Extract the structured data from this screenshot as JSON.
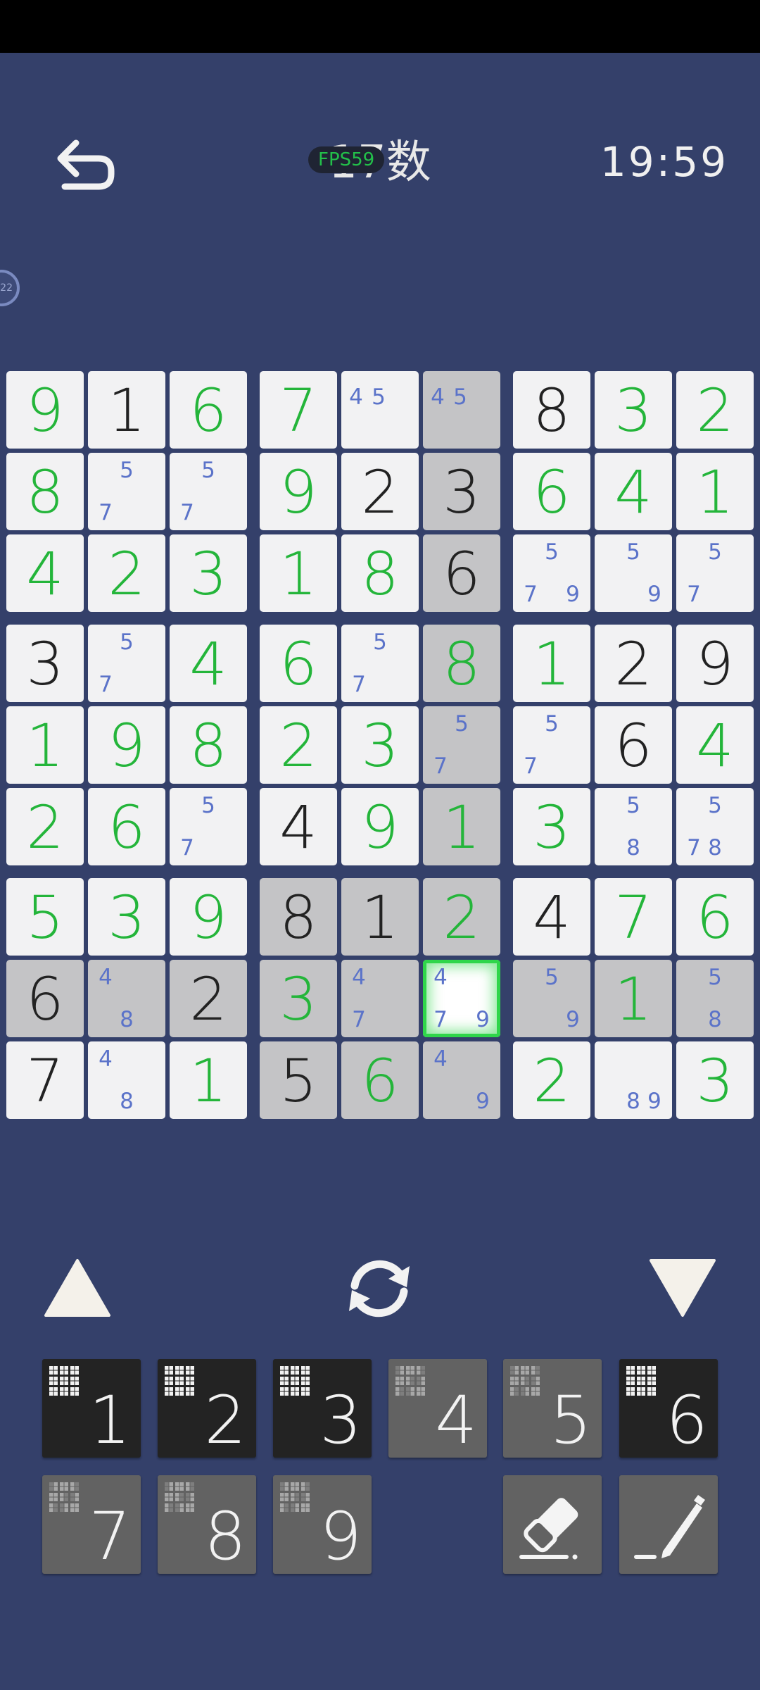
{
  "header": {
    "fps_label": "FPS59",
    "title": "17数",
    "timer": "19:59",
    "side_badge": "22"
  },
  "icons": {
    "back": "back-arrow-icon",
    "up": "triangle-up-icon",
    "down": "triangle-down-icon",
    "refresh": "refresh-icon",
    "eraser": "eraser-icon",
    "pencil": "pencil-icon",
    "mini_grid": "mini-grid-icon"
  },
  "colors": {
    "background": "#34406a",
    "given_digit": "#222222",
    "user_digit": "#24b53a",
    "note_digit": "#5b73c9",
    "highlight_cell": "#c4c4c6",
    "selected_outline": "#2fd64a"
  },
  "board": {
    "rows": [
      [
        {
          "v": "9",
          "t": "user"
        },
        {
          "v": "1",
          "t": "given"
        },
        {
          "v": "6",
          "t": "user"
        },
        {
          "v": "7",
          "t": "user"
        },
        {
          "n": [
            "4",
            "5"
          ]
        },
        {
          "n": [
            "4",
            "5"
          ],
          "hl": true
        },
        {
          "v": "8",
          "t": "given"
        },
        {
          "v": "3",
          "t": "user"
        },
        {
          "v": "2",
          "t": "user"
        }
      ],
      [
        {
          "v": "8",
          "t": "user"
        },
        {
          "n": [
            "5",
            "7"
          ]
        },
        {
          "n": [
            "5",
            "7"
          ]
        },
        {
          "v": "9",
          "t": "user"
        },
        {
          "v": "2",
          "t": "given"
        },
        {
          "v": "3",
          "t": "given",
          "hl": true
        },
        {
          "v": "6",
          "t": "user"
        },
        {
          "v": "4",
          "t": "user"
        },
        {
          "v": "1",
          "t": "user"
        }
      ],
      [
        {
          "v": "4",
          "t": "user"
        },
        {
          "v": "2",
          "t": "user"
        },
        {
          "v": "3",
          "t": "user"
        },
        {
          "v": "1",
          "t": "user"
        },
        {
          "v": "8",
          "t": "user"
        },
        {
          "v": "6",
          "t": "given",
          "hl": true
        },
        {
          "n": [
            "5",
            "7",
            "9"
          ]
        },
        {
          "n": [
            "5",
            "9"
          ]
        },
        {
          "n": [
            "5",
            "7"
          ]
        }
      ],
      [
        {
          "v": "3",
          "t": "given"
        },
        {
          "n": [
            "5",
            "7"
          ]
        },
        {
          "v": "4",
          "t": "user"
        },
        {
          "v": "6",
          "t": "user"
        },
        {
          "n": [
            "5",
            "7"
          ]
        },
        {
          "v": "8",
          "t": "user",
          "hl": true
        },
        {
          "v": "1",
          "t": "user"
        },
        {
          "v": "2",
          "t": "given"
        },
        {
          "v": "9",
          "t": "given"
        }
      ],
      [
        {
          "v": "1",
          "t": "user"
        },
        {
          "v": "9",
          "t": "user"
        },
        {
          "v": "8",
          "t": "user"
        },
        {
          "v": "2",
          "t": "user"
        },
        {
          "v": "3",
          "t": "user"
        },
        {
          "n": [
            "5",
            "7"
          ],
          "hl": true
        },
        {
          "n": [
            "5",
            "7"
          ]
        },
        {
          "v": "6",
          "t": "given"
        },
        {
          "v": "4",
          "t": "user"
        }
      ],
      [
        {
          "v": "2",
          "t": "user"
        },
        {
          "v": "6",
          "t": "user"
        },
        {
          "n": [
            "5",
            "7"
          ]
        },
        {
          "v": "4",
          "t": "given"
        },
        {
          "v": "9",
          "t": "user"
        },
        {
          "v": "1",
          "t": "user",
          "hl": true
        },
        {
          "v": "3",
          "t": "user"
        },
        {
          "n": [
            "5",
            "8"
          ]
        },
        {
          "n": [
            "5",
            "7",
            "8"
          ]
        }
      ],
      [
        {
          "v": "5",
          "t": "user"
        },
        {
          "v": "3",
          "t": "user"
        },
        {
          "v": "9",
          "t": "user"
        },
        {
          "v": "8",
          "t": "given",
          "hl": true
        },
        {
          "v": "1",
          "t": "given",
          "hl": true
        },
        {
          "v": "2",
          "t": "user",
          "hl": true
        },
        {
          "v": "4",
          "t": "given"
        },
        {
          "v": "7",
          "t": "user"
        },
        {
          "v": "6",
          "t": "user"
        }
      ],
      [
        {
          "v": "6",
          "t": "given",
          "hl": true
        },
        {
          "n": [
            "4",
            "8"
          ],
          "hl": true
        },
        {
          "v": "2",
          "t": "given",
          "hl": true
        },
        {
          "v": "3",
          "t": "user",
          "hl": true
        },
        {
          "n": [
            "4",
            "7"
          ],
          "hl": true
        },
        {
          "n": [
            "4",
            "7",
            "9"
          ],
          "sel": true
        },
        {
          "n": [
            "5",
            "9"
          ],
          "hl": true
        },
        {
          "v": "1",
          "t": "user",
          "hl": true
        },
        {
          "n": [
            "5",
            "8"
          ],
          "hl": true
        }
      ],
      [
        {
          "v": "7",
          "t": "given"
        },
        {
          "n": [
            "4",
            "8"
          ]
        },
        {
          "v": "1",
          "t": "user"
        },
        {
          "v": "5",
          "t": "given",
          "hl": true
        },
        {
          "v": "6",
          "t": "user",
          "hl": true
        },
        {
          "n": [
            "4",
            "9"
          ],
          "hl": true
        },
        {
          "v": "2",
          "t": "user"
        },
        {
          "n": [
            "8",
            "9"
          ]
        },
        {
          "v": "3",
          "t": "user"
        }
      ]
    ]
  },
  "keypad": [
    {
      "label": "1",
      "dim": false
    },
    {
      "label": "2",
      "dim": false
    },
    {
      "label": "3",
      "dim": false
    },
    {
      "label": "4",
      "dim": true
    },
    {
      "label": "5",
      "dim": true
    },
    {
      "label": "6",
      "dim": false
    },
    {
      "label": "7",
      "dim": true
    },
    {
      "label": "8",
      "dim": true
    },
    {
      "label": "9",
      "dim": true
    }
  ]
}
